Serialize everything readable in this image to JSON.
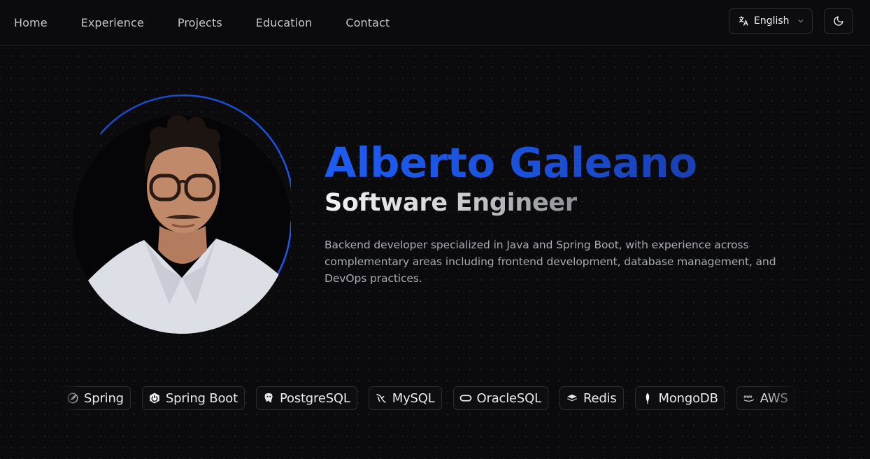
{
  "nav": {
    "links": [
      "Home",
      "Experience",
      "Projects",
      "Education",
      "Contact"
    ],
    "language": {
      "label": "English",
      "icon": "translate-icon"
    },
    "theme_icon": "moon-icon"
  },
  "hero": {
    "name": "Alberto Galeano",
    "role": "Software Engineer",
    "description": "Backend developer specialized in Java and Spring Boot, with experience across complementary areas including frontend development, database management, and DevOps practices.",
    "avatar": "profile-photo"
  },
  "tech": [
    {
      "label": "Spring",
      "icon": "spring-icon"
    },
    {
      "label": "Spring Boot",
      "icon": "spring-boot-icon"
    },
    {
      "label": "PostgreSQL",
      "icon": "postgresql-icon"
    },
    {
      "label": "MySQL",
      "icon": "mysql-icon"
    },
    {
      "label": "OracleSQL",
      "icon": "oracle-icon"
    },
    {
      "label": "Redis",
      "icon": "redis-icon"
    },
    {
      "label": "MongoDB",
      "icon": "mongodb-icon"
    },
    {
      "label": "AWS",
      "icon": "aws-icon"
    },
    {
      "label": "",
      "icon": "docker-icon"
    }
  ],
  "colors": {
    "background": "#0b0b0d",
    "accent": "#1d5cf2",
    "border": "#26272b",
    "muted_text": "#a9abb3"
  }
}
